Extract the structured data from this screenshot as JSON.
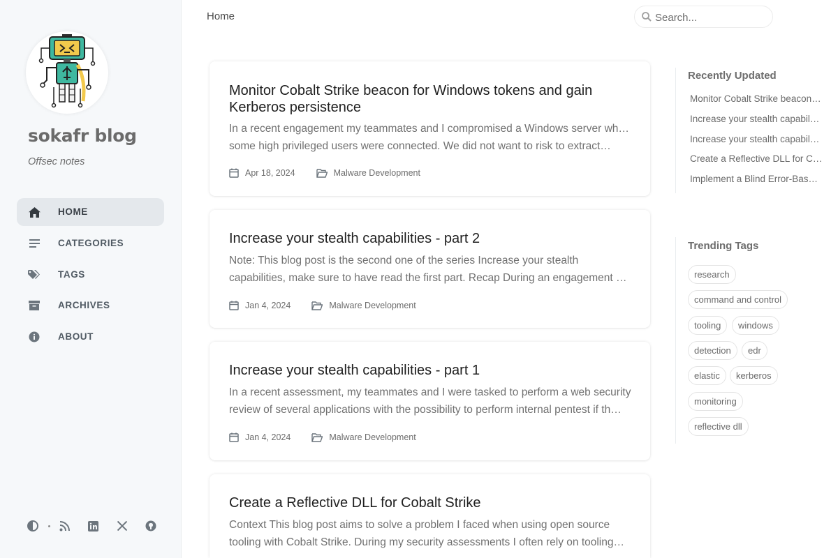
{
  "site": {
    "title": "sokafr blog",
    "subtitle": "Offsec notes"
  },
  "nav": {
    "items": [
      {
        "label": "HOME",
        "icon": "home-icon"
      },
      {
        "label": "CATEGORIES",
        "icon": "list-icon"
      },
      {
        "label": "TAGS",
        "icon": "tags-icon"
      },
      {
        "label": "ARCHIVES",
        "icon": "archive-icon"
      },
      {
        "label": "ABOUT",
        "icon": "info-icon"
      }
    ],
    "active": "HOME"
  },
  "sidebar_bottom": {
    "icons": [
      "theme-toggle-icon",
      "rss-icon",
      "linkedin-icon",
      "x-twitter-icon",
      "github-icon"
    ]
  },
  "topbar": {
    "breadcrumb": "Home",
    "search_placeholder": "Search..."
  },
  "posts": [
    {
      "title": "Monitor Cobalt Strike beacon for Windows tokens and gain Kerberos persistence",
      "excerpt_line1": "In a recent engagement my teammates and I compromised a Windows server where",
      "excerpt_line2": "some high privileged users were connected. We did not want to risk to extract…",
      "date": "Apr 18, 2024",
      "category": "Malware Development"
    },
    {
      "title": "Increase your stealth capabilities - part 2",
      "excerpt_line1": "Note: This blog post is the second one of the series Increase your stealth",
      "excerpt_line2": "capabilities, make sure to have read the first part. Recap During an engagement m…",
      "date": "Jan 4, 2024",
      "category": "Malware Development"
    },
    {
      "title": "Increase your stealth capabilities - part 1",
      "excerpt_line1": "In a recent assessment, my teammates and I were tasked to perform a web security",
      "excerpt_line2": "review of several applications with the possibility to perform internal pentest if th…",
      "date": "Jan 4, 2024",
      "category": "Malware Development"
    },
    {
      "title": "Create a Reflective DLL for Cobalt Strike",
      "excerpt_line1": "Context This blog post aims to solve a problem I faced when using open source",
      "excerpt_line2": "tooling with Cobalt Strike. During my security assessments I often rely on tooling…",
      "date": "",
      "category": ""
    }
  ],
  "recently_updated": {
    "heading": "Recently Updated",
    "items": [
      "Monitor Cobalt Strike beacon…",
      "Increase your stealth capabil…",
      "Increase your stealth capabil…",
      "Create a Reflective DLL for C…",
      "Implement a Blind Error-Bas…"
    ]
  },
  "trending_tags": {
    "heading": "Trending Tags",
    "tags": [
      "research",
      "command and control",
      "tooling",
      "windows",
      "detection",
      "edr",
      "elastic",
      "kerberos",
      "monitoring",
      "reflective dll"
    ]
  },
  "colors": {
    "sidebar_bg": "#f6f8fa",
    "active_nav_bg": "#e4e8ec",
    "avatar_accent": "#3fb8a0"
  }
}
